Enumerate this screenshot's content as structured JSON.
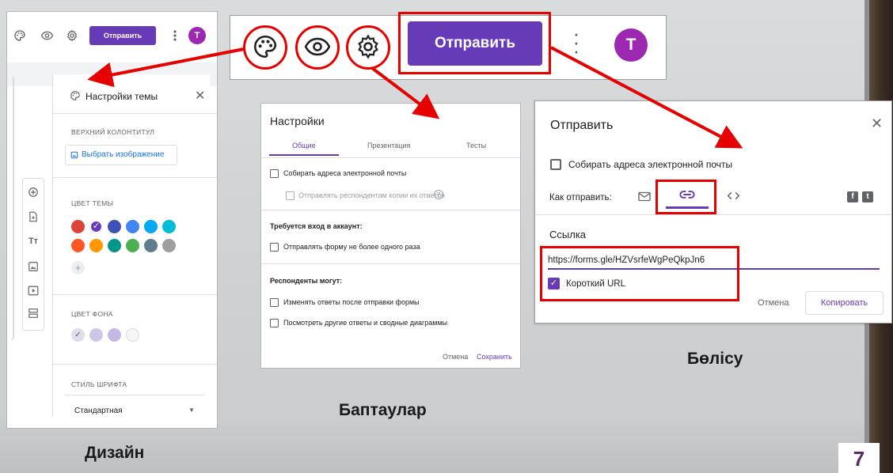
{
  "colors": {
    "brand_purple": "#673ab7",
    "avatar_purple": "#9c27b0",
    "highlight_red": "#e60000",
    "link_blue": "#1a73e8"
  },
  "toolbar": {
    "send_label": "Отправить",
    "avatar_letter": "T",
    "icons": [
      "palette-icon",
      "eye-icon",
      "gear-icon",
      "more-vert-icon"
    ]
  },
  "design": {
    "mini_send_label": "Отправить",
    "avatar_letter": "T",
    "sheet_title": "Настройки темы",
    "header_caption": "ВЕРХНИЙ КОЛОНТИТУЛ",
    "choose_image": "Выбрать изображение",
    "theme_color_caption": "ЦВЕТ ТЕМЫ",
    "theme_colors": [
      "#db4437",
      "#673ab7",
      "#3f51b5",
      "#4285f4",
      "#03a9f4",
      "#00bcd4",
      "#ff5722",
      "#ff9800",
      "#009688",
      "#4caf50",
      "#607d8b",
      "#9e9e9e"
    ],
    "selected_theme_color": "#673ab7",
    "background_caption": "ЦВЕТ ФОНА",
    "background_colors": [
      "#e0dce9",
      "#d1c4e9",
      "#c5b8e4",
      "#f6f6f6"
    ],
    "font_caption": "СТИЛЬ ШРИФТА",
    "font_value": "Стандартная",
    "side_tools": [
      "add-question-icon",
      "import-questions-icon",
      "title-text-icon",
      "image-icon",
      "video-icon",
      "section-icon"
    ]
  },
  "settings": {
    "title": "Настройки",
    "tabs": [
      "Общие",
      "Презентация",
      "Тесты"
    ],
    "active_tab": "Общие",
    "collect_emails": "Собирать адреса электронной почты",
    "send_copies": "Отправлять респондентам копии их ответов",
    "login_required_heading": "Требуется вход в аккаунт:",
    "limit_one_response": "Отправлять форму не более одного раза",
    "respondents_can_heading": "Респонденты могут:",
    "edit_after_submit": "Изменять ответы после отправки формы",
    "see_summary": "Посмотреть другие ответы и сводные диаграммы",
    "cancel": "Отмена",
    "save": "Сохранить"
  },
  "send": {
    "title": "Отправить",
    "collect_emails": "Собирать адреса электронной почты",
    "send_via_label": "Как отправить:",
    "link_heading": "Ссылка",
    "url": "https://forms.gle/HZVsrfeWgPeQkpJn6",
    "short_url_label": "Короткий URL",
    "short_url_checked": true,
    "cancel": "Отмена",
    "copy": "Копировать"
  },
  "captions": {
    "design": "Дизайн",
    "settings": "Баптаулар",
    "send": "Бөлісу"
  },
  "page_number": "7"
}
